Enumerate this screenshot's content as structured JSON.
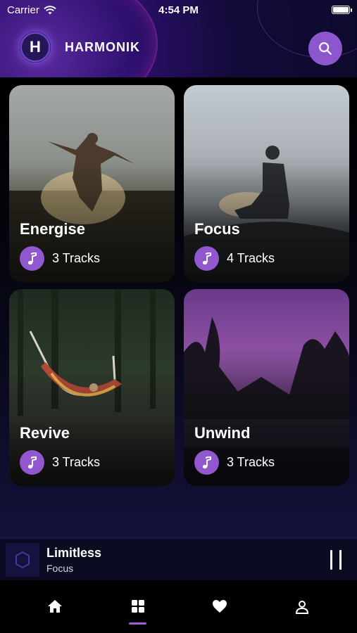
{
  "status_bar": {
    "carrier": "Carrier",
    "time": "4:54 PM"
  },
  "header": {
    "logo_letter": "H",
    "title": "HARMONIK",
    "search_icon": "search-icon"
  },
  "playlists": [
    {
      "title": "Energise",
      "tracks": "3 Tracks"
    },
    {
      "title": "Focus",
      "tracks": "4 Tracks"
    },
    {
      "title": "Revive",
      "tracks": "3 Tracks"
    },
    {
      "title": "Unwind",
      "tracks": "3 Tracks"
    }
  ],
  "now_playing": {
    "title": "Limitless",
    "playlist": "Focus"
  },
  "tabs": [
    {
      "icon": "home-icon"
    },
    {
      "icon": "grid-icon",
      "active": true
    },
    {
      "icon": "heart-icon"
    },
    {
      "icon": "user-icon"
    }
  ],
  "colors": {
    "accent": "#9157cf",
    "search_button": "#8c56cc",
    "background": "#000000",
    "player_bg": "#0b0b22"
  }
}
